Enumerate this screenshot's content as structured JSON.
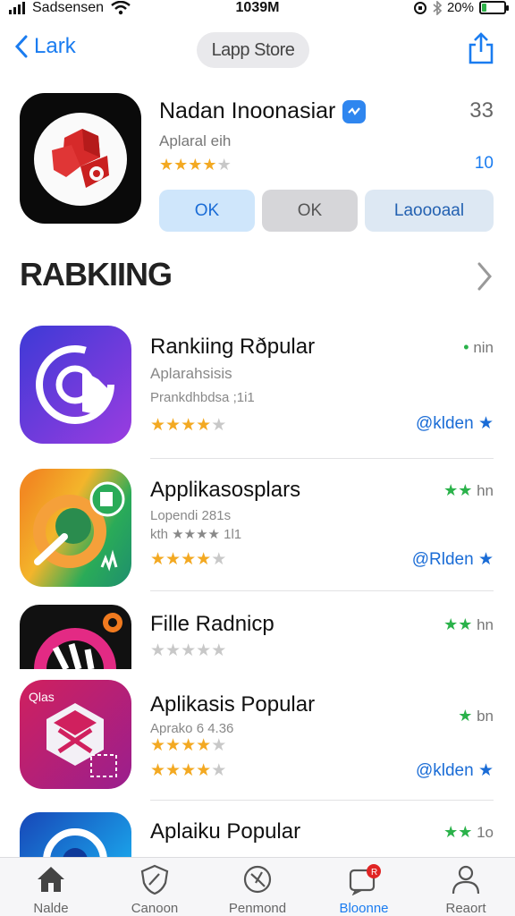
{
  "status_bar": {
    "carrier": "Sadsensen",
    "time": "1039M",
    "battery_pct": "20%",
    "battery_level": 0.2
  },
  "nav": {
    "back_label": "Lark",
    "title": "Lapp Store"
  },
  "header_app": {
    "name": "Nadan Inoonasiar",
    "subtitle": "Aplaral eih",
    "corner_mark": "33",
    "count": "10",
    "rating": 3.5,
    "buttons": {
      "ok_primary": "OK",
      "ok_secondary": "OK",
      "download": "Laoooaal"
    }
  },
  "section": {
    "title": "RABKIING"
  },
  "list": [
    {
      "name": "Rankiing Rðpular",
      "subtitle": "Aplarahsisis",
      "subtitle2": "Prankdhbdsa ;1i1",
      "meta_mark": "•",
      "meta": "nin",
      "rating": 4,
      "link": "@klden",
      "icon": "camera-swirl-icon"
    },
    {
      "name": "Applikasosplars",
      "subtitle": "Lopendi 281s",
      "subtitle2": "kth ★★★★ 1l1",
      "meta_mark": "★★",
      "meta": "hn",
      "rating": 4,
      "link": "@Rlden",
      "icon": "brush-icon"
    },
    {
      "name": "Fille Radnicp",
      "subtitle": "",
      "subtitle2": "",
      "meta_mark": "★★",
      "meta": "hn",
      "rating": 0,
      "link": "",
      "icon": "music-icon"
    },
    {
      "name": "Aplikasis Popular",
      "subtitle": "Aprako 6 4.36",
      "subtitle2": "",
      "meta_mark": "★",
      "meta": "bn",
      "rating": 4,
      "link": "@klden",
      "icon": "cube-icon",
      "badge": "Qlas"
    },
    {
      "name": "Aplaiku Popular",
      "subtitle": "",
      "subtitle2": "",
      "meta_mark": "★★",
      "meta": "1o",
      "rating": 0,
      "link": "",
      "icon": "blue-swirl-icon"
    }
  ],
  "tabbar": {
    "tabs": [
      {
        "label": "Nalde",
        "icon": "home-icon"
      },
      {
        "label": "Canoon",
        "icon": "shield-icon"
      },
      {
        "label": "Penmond",
        "icon": "compass-icon"
      },
      {
        "label": "Bloonne",
        "icon": "inbox-icon",
        "badge": "R"
      },
      {
        "label": "Reaort",
        "icon": "person-icon"
      }
    ],
    "active_index": 3
  },
  "colors": {
    "accent": "#1a7cf0",
    "star": "#f3a922",
    "green": "#2ab24a"
  }
}
